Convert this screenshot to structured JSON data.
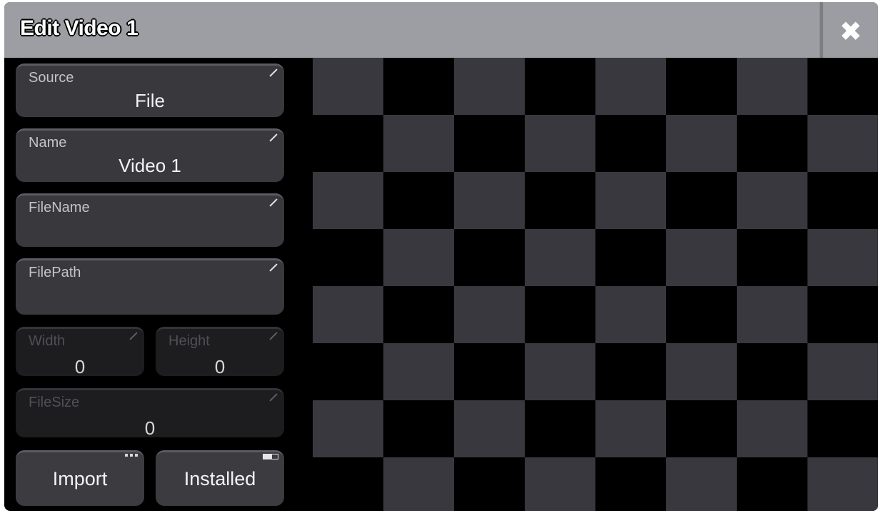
{
  "window": {
    "title": "Edit Video 1",
    "close_icon": "close-icon"
  },
  "fields": {
    "source": {
      "label": "Source",
      "value": "File"
    },
    "name": {
      "label": "Name",
      "value": "Video 1"
    },
    "filename": {
      "label": "FileName",
      "value": ""
    },
    "filepath": {
      "label": "FilePath",
      "value": ""
    },
    "width": {
      "label": "Width",
      "value": "0"
    },
    "height": {
      "label": "Height",
      "value": "0"
    },
    "filesize": {
      "label": "FileSize",
      "value": "0"
    }
  },
  "buttons": {
    "import": {
      "label": "Import",
      "icon": "more-dots-icon"
    },
    "installed": {
      "label": "Installed",
      "icon": "toggle-icon"
    }
  },
  "preview": {
    "pattern": "checkerboard",
    "colors": {
      "light": "#38383e",
      "dark": "#000000"
    }
  }
}
